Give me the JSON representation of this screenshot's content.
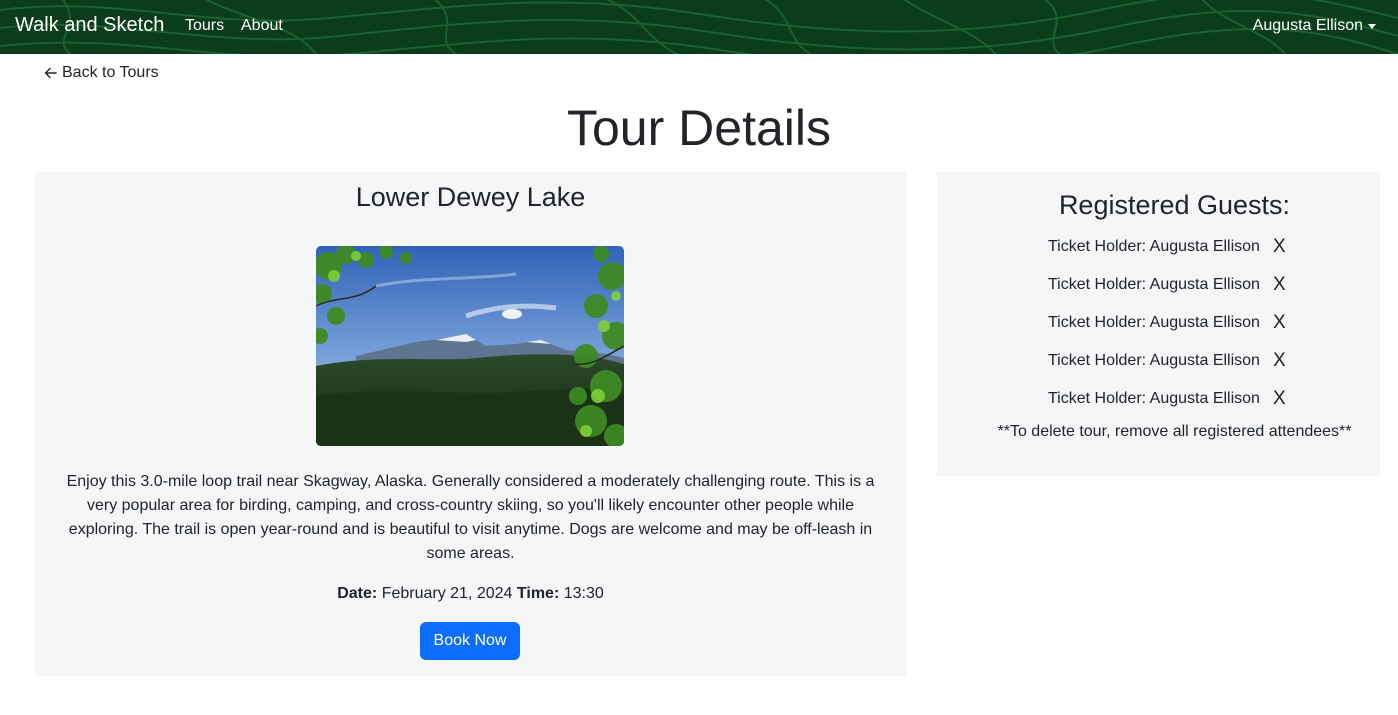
{
  "navbar": {
    "brand": "Walk and Sketch",
    "links": [
      "Tours",
      "About"
    ],
    "user": "Augusta Ellison",
    "background_color": "#0b3d1c"
  },
  "back_link": "Back to Tours",
  "page_title": "Tour Details",
  "tour": {
    "name": "Lower Dewey Lake",
    "image_icon": "mountain-landscape-image",
    "description": "Enjoy this 3.0-mile loop trail near Skagway, Alaska. Generally considered a moderately challenging route. This is a very popular area for birding, camping, and cross-country skiing, so you'll likely encounter other people while exploring. The trail is open year-round and is beautiful to visit anytime. Dogs are welcome and may be off-leash in some areas.",
    "date_label": "Date:",
    "date": "February 21, 2024",
    "time_label": "Time:",
    "time": "13:30",
    "book_button": "Book Now"
  },
  "guests": {
    "title": "Registered Guests:",
    "items": [
      {
        "label": "Ticket Holder: Augusta Ellison",
        "remove": "X"
      },
      {
        "label": "Ticket Holder: Augusta Ellison",
        "remove": "X"
      },
      {
        "label": "Ticket Holder: Augusta Ellison",
        "remove": "X"
      },
      {
        "label": "Ticket Holder: Augusta Ellison",
        "remove": "X"
      },
      {
        "label": "Ticket Holder: Augusta Ellison",
        "remove": "X"
      }
    ],
    "note": "**To delete tour, remove all registered attendees**"
  },
  "colors": {
    "accent": "#0d6efd",
    "card_bg": "#f5f6f8"
  }
}
